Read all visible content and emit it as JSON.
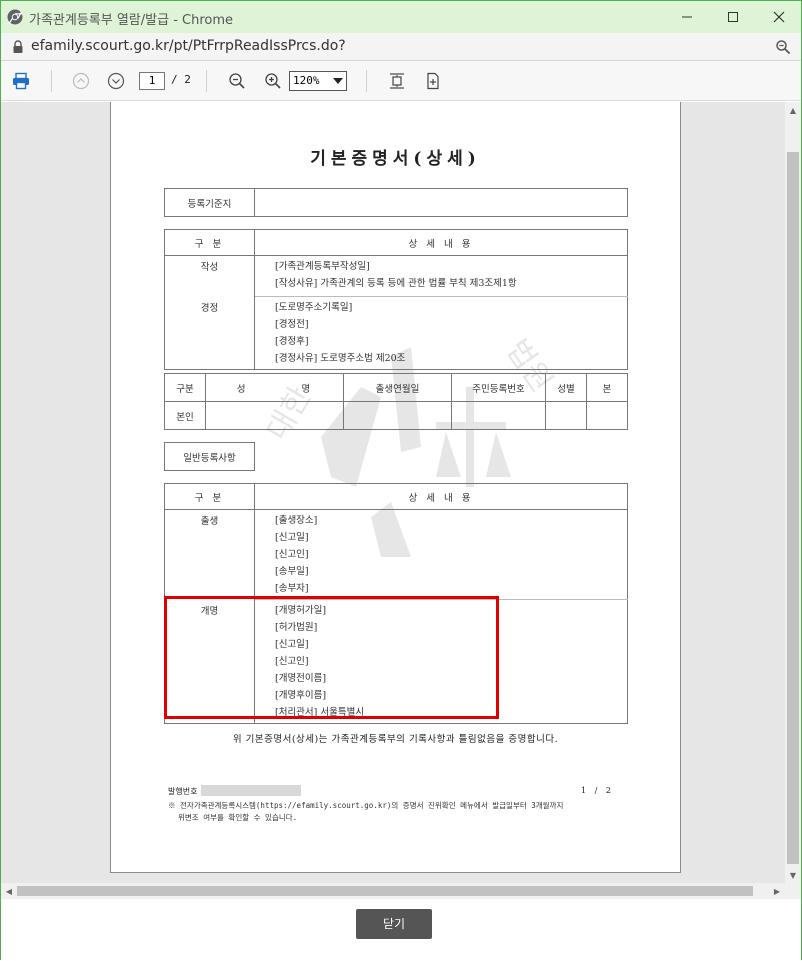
{
  "window": {
    "title": "가족관계등록부 열람/발급 - Chrome",
    "url": "efamily.scourt.go.kr/pt/PtFrrpReadIssPrcs.do?"
  },
  "toolbar": {
    "current_page": "1",
    "page_total": "/ 2",
    "zoom": "120%"
  },
  "document": {
    "title": "기본증명서(상세)",
    "registry_label": "등록기준지",
    "registry_value": "",
    "section1": {
      "header_category": "구 분",
      "header_details": "상 세 내 용",
      "rows": [
        {
          "category": "작성",
          "lines": [
            "[가족관계등록부작성일]",
            "[작성사유]   가족관계의 등록 등에 관한 법률 부칙 제3조제1항"
          ]
        },
        {
          "category": "경정",
          "lines": [
            "[도로명주소기록일]",
            "[경정전]",
            "[경정후]",
            "[경정사유]   도로명주소법 제20조"
          ]
        }
      ]
    },
    "person": {
      "headers": [
        "구분",
        "성",
        "명",
        "출생연월일",
        "주민등록번호",
        "성별",
        "본"
      ],
      "row_label": "본인"
    },
    "general_label": "일반등록사항",
    "section2": {
      "header_category": "구 분",
      "header_details": "상 세 내 용",
      "rows": [
        {
          "category": "출생",
          "lines": [
            "[출생장소]",
            "[신고일]",
            "[신고인]",
            "[송부일]",
            "[송부자]"
          ]
        },
        {
          "category": "개명",
          "lines": [
            "[개명허가일]",
            "[허가법원]",
            "[신고일]",
            "[신고인]",
            "[개명전이름]",
            "[개명후이름]",
            "[처리관서]   서울특별시"
          ]
        }
      ]
    },
    "statement": "위 기본증명서(상세)는 가족관계등록부의 기록사항과 틀림없음을 증명합니다.",
    "issue_label": "발행번호 :",
    "page_indicator": "1 / 2",
    "note_line1": "※ 전자가족관계등록시스템(https://efamily.scourt.go.kr)의 증명서 진위확인 메뉴에서 발급일부터 3개월까지",
    "note_line2": "위변조 여부를 확인할 수 있습니다."
  },
  "footer": {
    "close_label": "닫기"
  },
  "colors": {
    "title_bar": "#dff3d7",
    "window_border": "#4caf50",
    "highlight": "#e00000",
    "close_button": "#555555"
  }
}
